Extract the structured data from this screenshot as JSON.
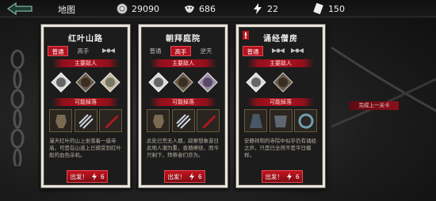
{
  "header": {
    "title": "地图",
    "resources": [
      {
        "name": "coins",
        "value": "29090"
      },
      {
        "name": "souls",
        "value": "686"
      },
      {
        "name": "energy",
        "value": "22"
      },
      {
        "name": "tickets",
        "value": "150"
      }
    ]
  },
  "cards": [
    {
      "title": "红叶山路",
      "difficulties": [
        "普通",
        "高手"
      ],
      "enemies_label": "主要敌人",
      "drops_label": "可能掉落",
      "description": "漫天红叶的山上坐落着一座寺庙，可是在山道上已感受到红叶般的血色杀机。",
      "go_label": "出发！",
      "cost": "6"
    },
    {
      "title": "朝拜庭院",
      "difficulties": [
        "普通",
        "高手",
        "逆天"
      ],
      "enemies_label": "主要敌人",
      "drops_label": "可能掉落",
      "description": "此处已荒无人烟，寂寥想象昔日此地人潮为重，香烟缭绕，而今只剩下，拜祭者们亦为。",
      "go_label": "出发！",
      "cost": "6"
    },
    {
      "title": "诵经僧房",
      "difficulties": [
        "普通"
      ],
      "enemies_label": "主要敌人",
      "drops_label": "可能掉落",
      "description": "安静祥和的寺院中似乎仍有诵经之声，只是已全然不是平日模样。",
      "go_label": "出发！",
      "cost": "6"
    }
  ],
  "side_label": "完成上一关卡"
}
